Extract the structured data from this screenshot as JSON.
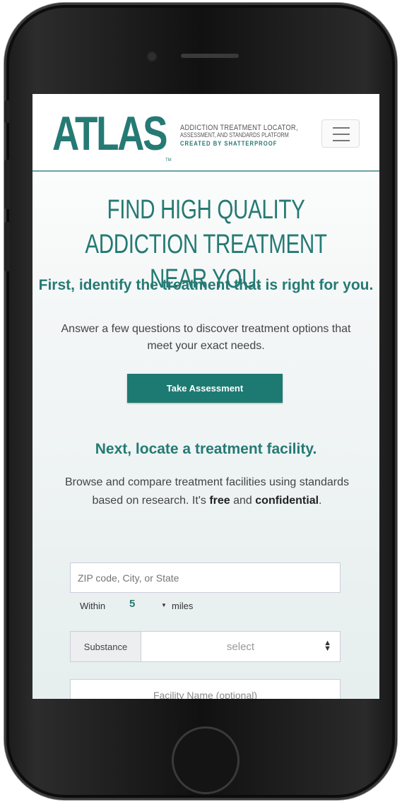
{
  "header": {
    "logo": "ATLAS",
    "tm": "TM",
    "tagline_line1": "ADDICTION TREATMENT LOCATOR,",
    "tagline_line2": "ASSESSMENT, AND STANDARDS PLATFORM",
    "tagline_line3": "CREATED BY SHATTERPROOF"
  },
  "hero": {
    "headline": "FIND HIGH QUALITY ADDICTION TREATMENT NEAR YOU.",
    "step1_title": "First, identify the treatment that is right for you.",
    "step1_desc": "Answer a few questions to discover treatment options that meet your exact needs.",
    "cta_label": "Take Assessment"
  },
  "locator": {
    "step2_title": "Next, locate a treatment facility.",
    "desc_part1": "Browse and compare treatment facilities using standards based on research. It's ",
    "desc_free": "free",
    "desc_and": " and ",
    "desc_confidential": "confidential",
    "desc_end": ".",
    "location_placeholder": "ZIP code, City, or State",
    "within_label": "Within",
    "within_value": "5",
    "within_unit": "miles",
    "substance_label": "Substance",
    "substance_value": "select",
    "facility_placeholder": "Facility Name (optional)"
  },
  "colors": {
    "brand": "#257a74",
    "cta": "#1d7a72"
  }
}
